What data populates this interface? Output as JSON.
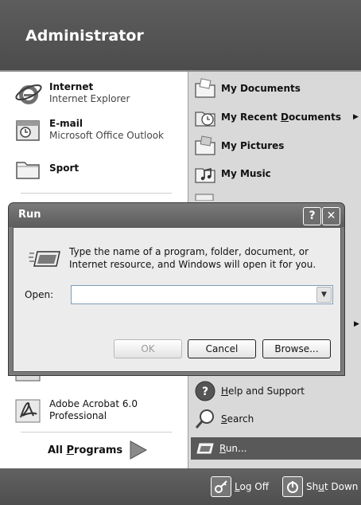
{
  "header": {
    "user_name": "Administrator"
  },
  "left_pane": {
    "pinned": [
      {
        "title": "Internet",
        "subtitle": "Internet Explorer",
        "icon": "internet-explorer-icon"
      },
      {
        "title": "E-mail",
        "subtitle": "Microsoft Office Outlook",
        "icon": "outlook-icon"
      },
      {
        "title": "Sport",
        "subtitle": "",
        "icon": "folder-icon"
      }
    ],
    "recent": [
      {
        "title": "Adobe Acrobat 6.0",
        "subtitle": "Professional",
        "icon": "acrobat-icon"
      }
    ],
    "all_programs_pre": "All ",
    "all_programs_accel": "P",
    "all_programs_post": "rograms"
  },
  "right_pane": {
    "items": [
      {
        "pre": "My Documents",
        "accel": "",
        "post": "",
        "icon": "my-documents-icon",
        "arrow": ""
      },
      {
        "pre": "My Recent ",
        "accel": "D",
        "post": "ocuments",
        "icon": "recent-documents-icon",
        "arrow": "▶"
      },
      {
        "pre": "My Pictures",
        "accel": "",
        "post": "",
        "icon": "my-pictures-icon",
        "arrow": ""
      },
      {
        "pre": "My Music",
        "accel": "",
        "post": "",
        "icon": "my-music-icon",
        "arrow": ""
      },
      {
        "pre": "",
        "accel": "H",
        "post": "elp and Support",
        "icon": "help-icon",
        "arrow": ""
      },
      {
        "pre": "",
        "accel": "S",
        "post": "earch",
        "icon": "search-icon",
        "arrow": ""
      },
      {
        "pre": "",
        "accel": "R",
        "post": "un...",
        "icon": "run-icon",
        "arrow": ""
      }
    ],
    "hidden_arrow": "▶"
  },
  "footer": {
    "logoff_accel": "L",
    "logoff_post": "og Off",
    "shutdown_pre": "Sh",
    "shutdown_accel": "u",
    "shutdown_post": "t Down"
  },
  "run_dialog": {
    "title": "Run",
    "help_glyph": "?",
    "close_glyph": "✕",
    "message": "Type the name of a program, folder, document, or Internet resource, and Windows will open it for you.",
    "open_label": "Open:",
    "open_value": "",
    "dropdown_glyph": "▼",
    "ok_label": "OK",
    "cancel_label": "Cancel",
    "browse_label": "Browse..."
  }
}
